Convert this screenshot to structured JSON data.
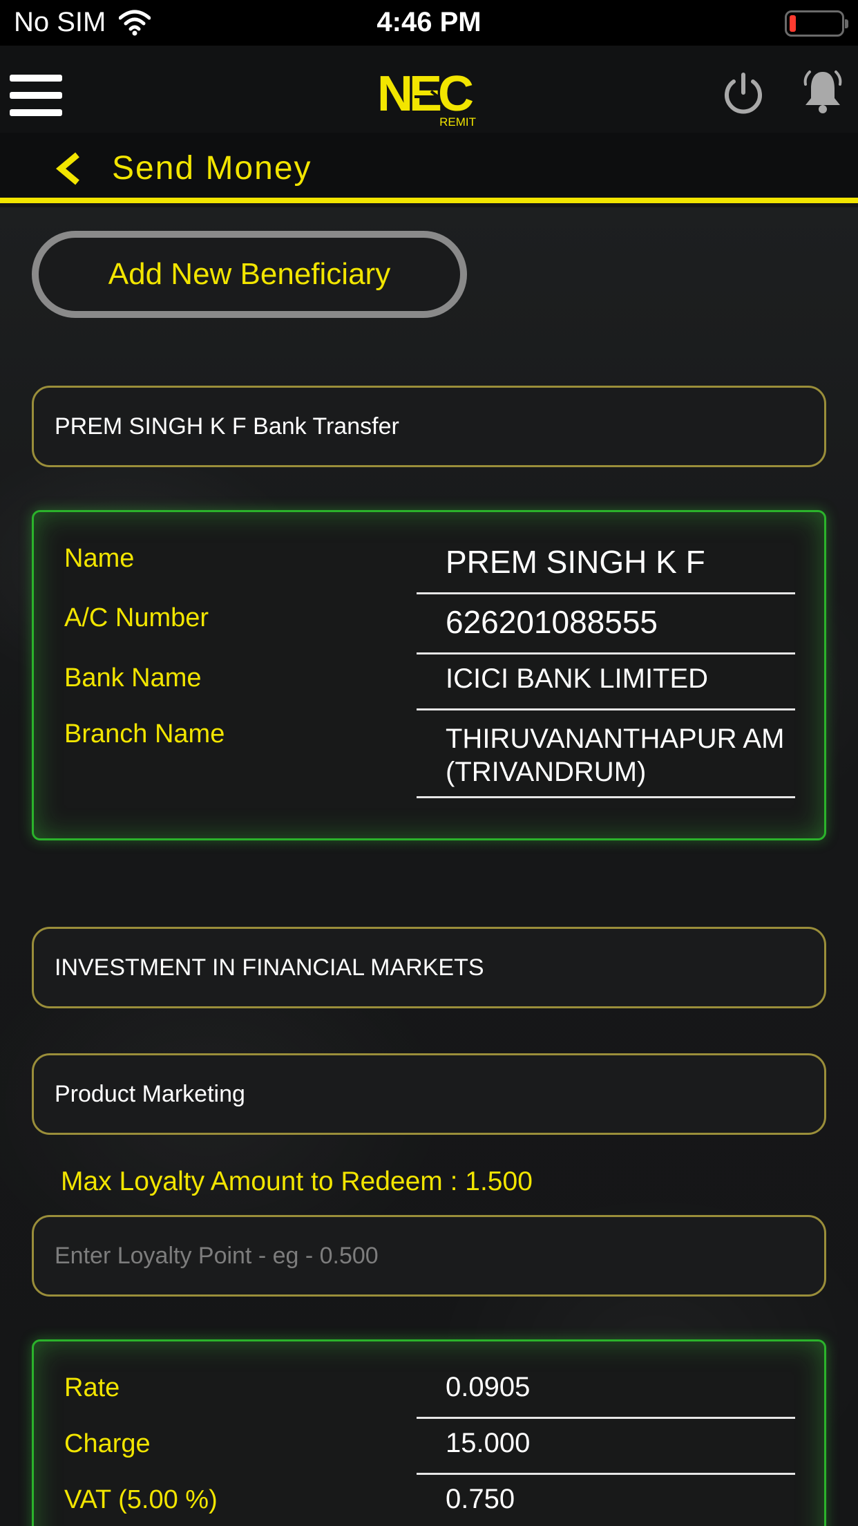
{
  "status_bar": {
    "carrier": "No SIM",
    "time": "4:46 PM",
    "battery_color": "#ff3b30"
  },
  "header": {
    "logo_main": "NEC",
    "logo_sub": "REMIT",
    "accent_color": "#f2e500"
  },
  "title_bar": {
    "title": "Send Money"
  },
  "add_beneficiary": {
    "label": "Add New Beneficiary"
  },
  "beneficiary_select": {
    "value": "PREM SINGH K F Bank Transfer"
  },
  "beneficiary_details": {
    "name_label": "Name",
    "name_value": "PREM SINGH K F",
    "account_label": "A/C Number",
    "account_value": "626201088555",
    "bank_label": "Bank Name",
    "bank_value": "ICICI BANK LIMITED",
    "branch_label": "Branch Name",
    "branch_value": "THIRUVANANTHAPUR AM (TRIVANDRUM)"
  },
  "purpose_select": {
    "value": "INVESTMENT IN FINANCIAL MARKETS"
  },
  "source_select": {
    "value": "Product Marketing"
  },
  "loyalty": {
    "max_label": "Max Loyalty Amount to Redeem : 1.500",
    "placeholder": "Enter Loyalty Point - eg - 0.500"
  },
  "summary": {
    "rate_label": "Rate",
    "rate_value": "0.0905",
    "charge_label": "Charge",
    "charge_value": "15.000",
    "vat_label": "VAT (5.00 %)",
    "vat_value": "0.750"
  }
}
